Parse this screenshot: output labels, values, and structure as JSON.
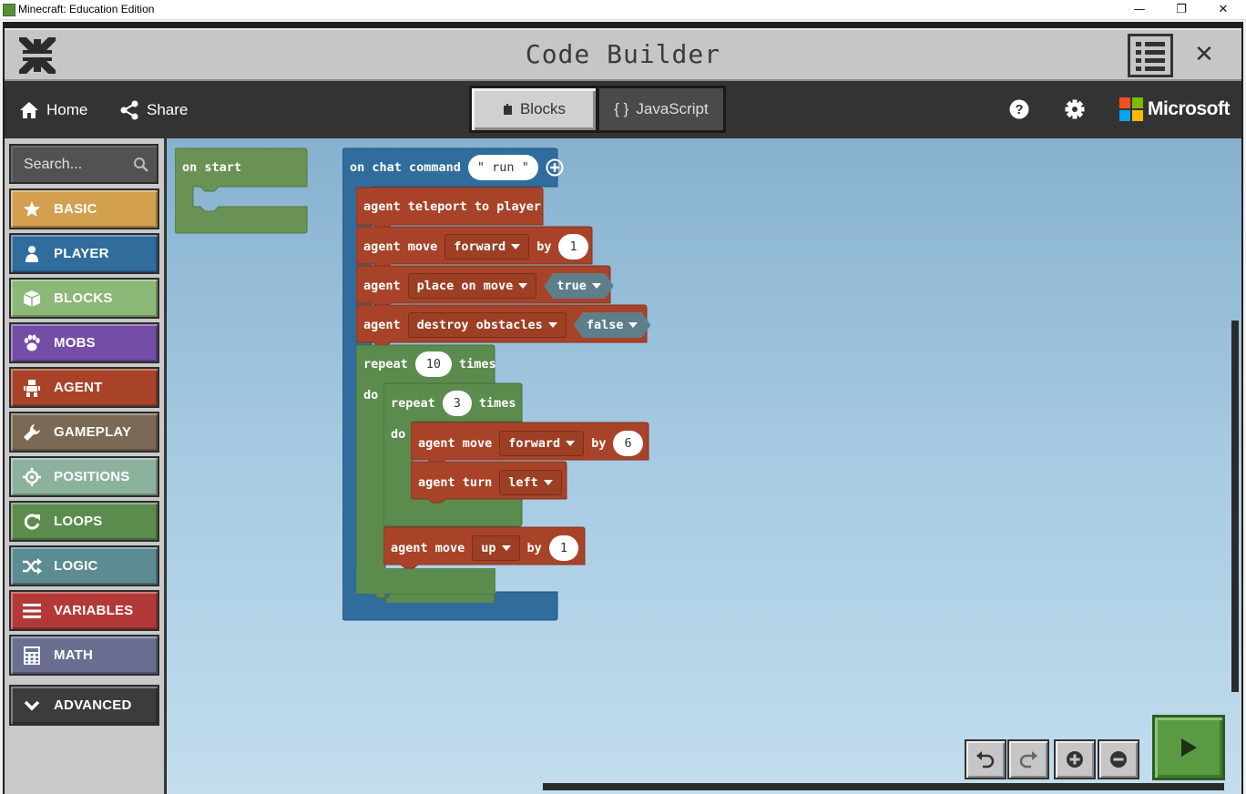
{
  "window": {
    "title": "Minecraft: Education Edition",
    "minimize": "—",
    "restore": "❐",
    "close": "✕"
  },
  "header": {
    "title": "Code Builder",
    "close": "✕"
  },
  "toolbar": {
    "home": "Home",
    "share": "Share",
    "tab_blocks": "Blocks",
    "tab_js": "JavaScript",
    "brand": "Microsoft"
  },
  "sidebar": {
    "search_placeholder": "Search...",
    "categories": [
      {
        "label": "BASIC",
        "color": "#d3a04f"
      },
      {
        "label": "PLAYER",
        "color": "#306c9c"
      },
      {
        "label": "BLOCKS",
        "color": "#8cb877"
      },
      {
        "label": "MOBS",
        "color": "#744ea6"
      },
      {
        "label": "AGENT",
        "color": "#a8432a"
      },
      {
        "label": "GAMEPLAY",
        "color": "#7a6a55"
      },
      {
        "label": "POSITIONS",
        "color": "#8cb29e"
      },
      {
        "label": "LOOPS",
        "color": "#5b8b4d"
      },
      {
        "label": "LOGIC",
        "color": "#5c8c92"
      },
      {
        "label": "VARIABLES",
        "color": "#b33838"
      },
      {
        "label": "MATH",
        "color": "#6a6f92"
      },
      {
        "label": "ADVANCED",
        "color": "#3c3c3c"
      }
    ]
  },
  "workspace": {
    "on_start": "on start",
    "chat": {
      "label": "on chat command",
      "value": "\" run \""
    },
    "teleport": "agent teleport to player",
    "move1": {
      "label": "agent move",
      "dir": "forward",
      "by": "by",
      "value": "1"
    },
    "place": {
      "label": "agent",
      "option": "place on move",
      "value": "true"
    },
    "destroy": {
      "label": "agent",
      "option": "destroy obstacles",
      "value": "false"
    },
    "repeat_outer": {
      "label": "repeat",
      "value": "10",
      "suffix": "times",
      "do": "do"
    },
    "repeat_inner": {
      "label": "repeat",
      "value": "3",
      "suffix": "times",
      "do": "do"
    },
    "move2": {
      "label": "agent move",
      "dir": "forward",
      "by": "by",
      "value": "6"
    },
    "turn": {
      "label": "agent turn",
      "dir": "left"
    },
    "move3": {
      "label": "agent move",
      "dir": "up",
      "by": "by",
      "value": "1"
    }
  }
}
